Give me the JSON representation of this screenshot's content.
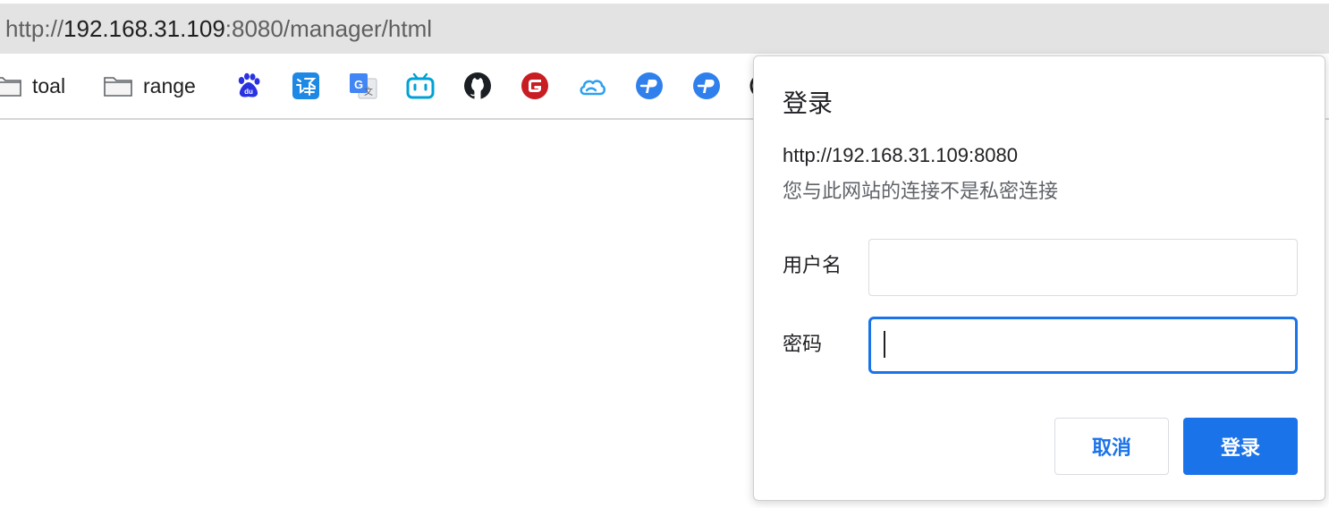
{
  "address_bar": {
    "scheme": "http://",
    "host": "192.168.31.109",
    "rest": ":8080/manager/html"
  },
  "bookmarks": [
    {
      "label": "toal",
      "icon": "folder-icon"
    },
    {
      "label": "range",
      "icon": "folder-icon"
    },
    {
      "icon": "baidu-icon"
    },
    {
      "icon": "translate-icon"
    },
    {
      "icon": "google-translate-icon"
    },
    {
      "icon": "bilibili-icon"
    },
    {
      "icon": "github-icon"
    },
    {
      "icon": "gitee-icon"
    },
    {
      "icon": "cloud-icon"
    },
    {
      "icon": "bookmark-p-icon"
    },
    {
      "icon": "bookmark-p-icon"
    }
  ],
  "dialog": {
    "title": "登录",
    "origin": "http://192.168.31.109:8080",
    "warning": "您与此网站的连接不是私密连接",
    "username_label": "用户名",
    "username_value": "",
    "password_label": "密码",
    "password_value": "",
    "cancel_label": "取消",
    "login_label": "登录"
  },
  "colors": {
    "accent": "#1a73e8",
    "address_bar_bg": "#e3e3e3"
  }
}
